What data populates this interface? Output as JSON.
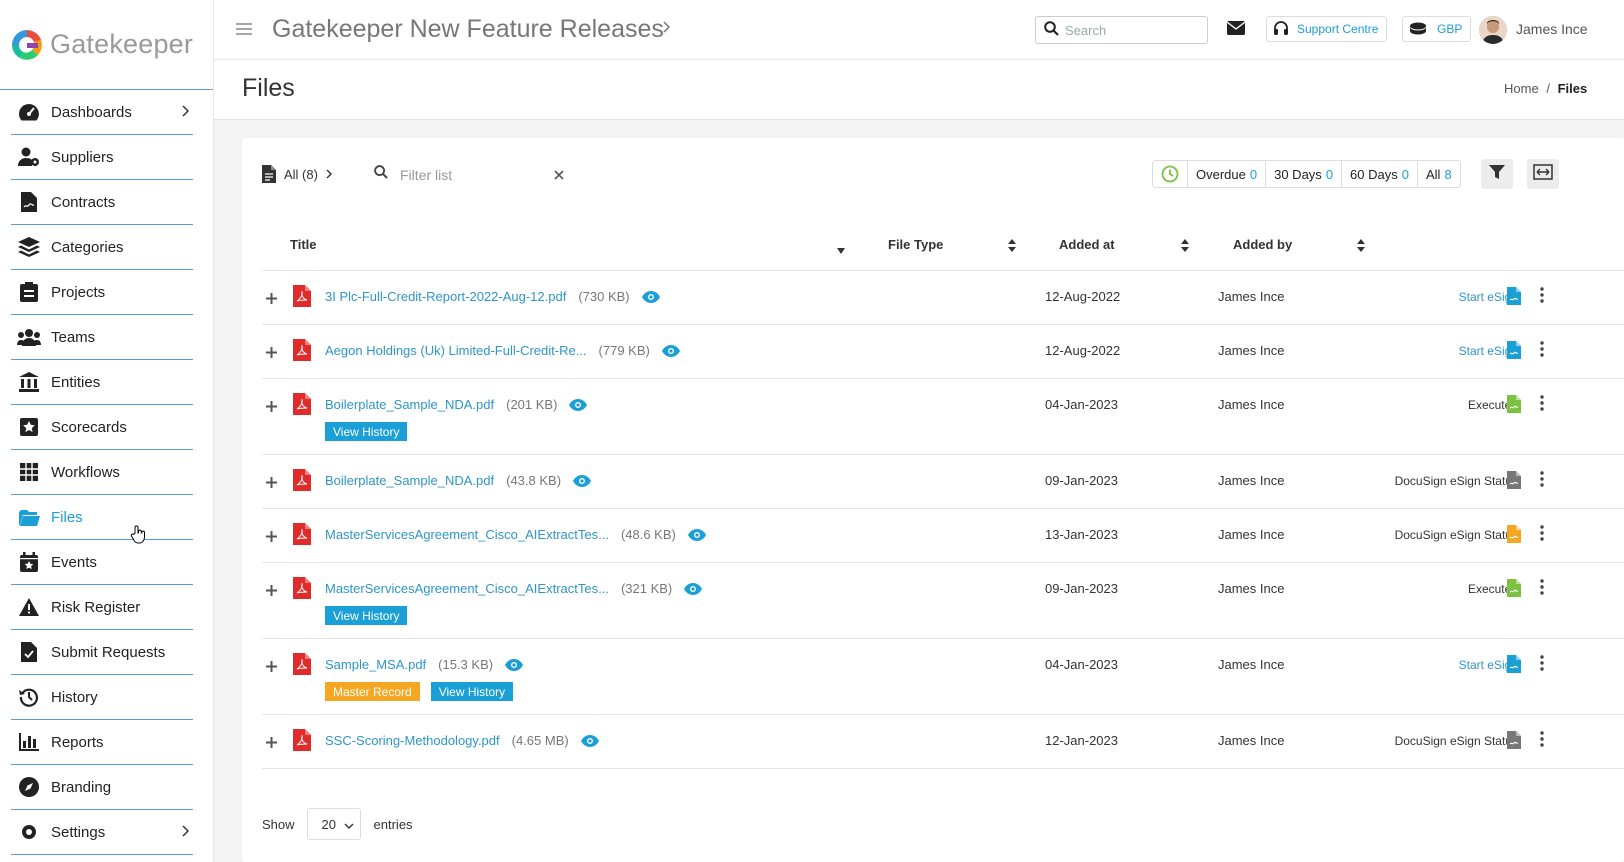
{
  "app": {
    "logo_text": "Gatekeeper",
    "title": "Gatekeeper New Feature Releases"
  },
  "topbar": {
    "search_placeholder": "Search",
    "support_label": "Support Centre",
    "currency_label": "GBP",
    "user_name": "James Ince"
  },
  "sidebar": {
    "items": [
      {
        "label": "Dashboards",
        "icon": "gauge-icon"
      },
      {
        "label": "Suppliers",
        "icon": "user-cog-icon"
      },
      {
        "label": "Contracts",
        "icon": "contract-icon"
      },
      {
        "label": "Categories",
        "icon": "layers-icon"
      },
      {
        "label": "Projects",
        "icon": "clipboard-icon"
      },
      {
        "label": "Teams",
        "icon": "users-icon"
      },
      {
        "label": "Entities",
        "icon": "bank-icon"
      },
      {
        "label": "Scorecards",
        "icon": "star-square-icon"
      },
      {
        "label": "Workflows",
        "icon": "table-icon"
      },
      {
        "label": "Files",
        "icon": "folder-icon"
      },
      {
        "label": "Events",
        "icon": "calendar-star-icon"
      },
      {
        "label": "Risk Register",
        "icon": "warning-icon"
      },
      {
        "label": "Submit Requests",
        "icon": "file-check-icon"
      },
      {
        "label": "History",
        "icon": "history-icon"
      },
      {
        "label": "Reports",
        "icon": "bar-chart-icon"
      },
      {
        "label": "Branding",
        "icon": "compass-icon"
      },
      {
        "label": "Settings",
        "icon": "gear-icon"
      }
    ]
  },
  "page": {
    "title": "Files",
    "breadcrumb_home": "Home",
    "breadcrumb_sep": "/",
    "breadcrumb_current": "Files"
  },
  "toolbar": {
    "all_label": "All (8)",
    "filter_placeholder": "Filter list",
    "segments": [
      {
        "label": "Overdue",
        "count": "0"
      },
      {
        "label": "30 Days",
        "count": "0"
      },
      {
        "label": "60 Days",
        "count": "0"
      },
      {
        "label": "All",
        "count": "8"
      }
    ]
  },
  "table": {
    "headers": {
      "title": "Title",
      "file_type": "File Type",
      "added_at": "Added at",
      "added_by": "Added by"
    },
    "rows": [
      {
        "name": "3I Plc-Full-Credit-Report-2022-Aug-12.pdf",
        "size": "(730 KB)",
        "date": "12-Aug-2022",
        "by": "James Ince",
        "status": "Start eSign",
        "tags": []
      },
      {
        "name": "Aegon Holdings (Uk) Limited-Full-Credit-Re...",
        "size": "(779 KB)",
        "date": "12-Aug-2022",
        "by": "James Ince",
        "status": "Start eSign",
        "tags": []
      },
      {
        "name": "Boilerplate_Sample_NDA.pdf",
        "size": "(201 KB)",
        "date": "04-Jan-2023",
        "by": "James Ince",
        "status": "Executed",
        "tags": [
          "View History"
        ]
      },
      {
        "name": "Boilerplate_Sample_NDA.pdf",
        "size": "(43.8 KB)",
        "date": "09-Jan-2023",
        "by": "James Ince",
        "status": "DocuSign eSign Status",
        "tags": []
      },
      {
        "name": "MasterServicesAgreement_Cisco_AIExtractTes...",
        "size": "(48.6 KB)",
        "date": "13-Jan-2023",
        "by": "James Ince",
        "status": "DocuSign eSign Status",
        "tags": []
      },
      {
        "name": "MasterServicesAgreement_Cisco_AIExtractTes...",
        "size": "(321 KB)",
        "date": "09-Jan-2023",
        "by": "James Ince",
        "status": "Executed",
        "tags": [
          "View History"
        ]
      },
      {
        "name": "Sample_MSA.pdf",
        "size": "(15.3 KB)",
        "date": "04-Jan-2023",
        "by": "James Ince",
        "status": "Start eSign",
        "tags": [
          "Master Record",
          "View History"
        ]
      },
      {
        "name": "SSC-Scoring-Methodology.pdf",
        "size": "(4.65 MB)",
        "date": "12-Jan-2023",
        "by": "James Ince",
        "status": "DocuSign eSign Status",
        "tags": []
      }
    ]
  },
  "footer": {
    "show_label": "Show",
    "page_size": "20",
    "entries_label": "entries"
  },
  "colors": {
    "accent": "#1a9fd6",
    "link": "#2e95c9",
    "master_record": "#f5a623",
    "pdf_red": "#e02b2b",
    "esign_blue": "#1a9fd6",
    "executed_green": "#7cc142",
    "status_grey": "#777777",
    "status_orange": "#f5a623"
  }
}
